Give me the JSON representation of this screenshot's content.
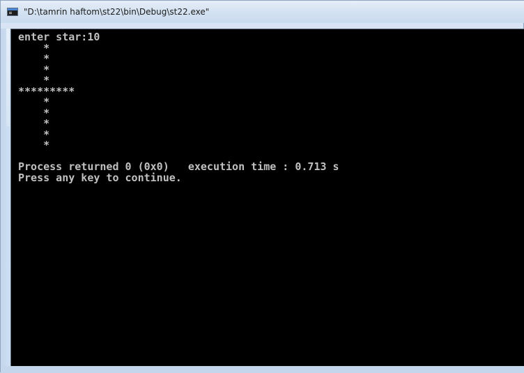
{
  "window": {
    "title": "\"D:\\tamrin haftom\\st22\\bin\\Debug\\st22.exe\"",
    "icon": "console-app-icon"
  },
  "console": {
    "lines": [
      "enter star:10",
      "    *",
      "    *",
      "    *",
      "    *",
      "*********",
      "    *",
      "    *",
      "    *",
      "    *",
      "    *",
      "",
      "Process returned 0 (0x0)   execution time : 0.713 s",
      "Press any key to continue."
    ]
  },
  "colors": {
    "console_background": "#000000",
    "console_text": "#c0c0c0",
    "window_frame": "#c6d8ee"
  }
}
